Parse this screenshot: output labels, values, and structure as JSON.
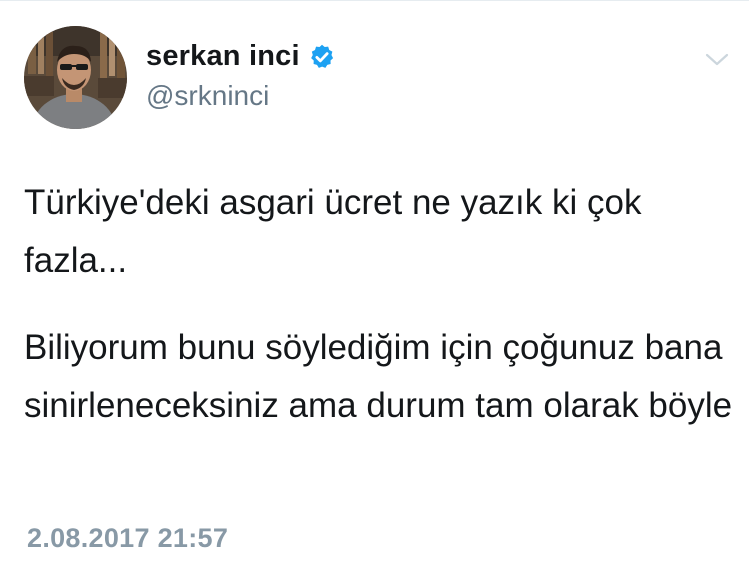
{
  "tweet": {
    "author": {
      "display_name": "serkan inci",
      "handle": "@srkninci",
      "verified_icon": "verified-badge-icon",
      "avatar_icon": "avatar-photo"
    },
    "menu_icon": "chevron-down-icon",
    "paragraphs": [
      "Türkiye'deki asgari ücret ne yazık ki çok fazla...",
      "Biliyorum bunu söylediğim için çoğunuz bana sinirleneceksiniz ama durum tam olarak böyle"
    ],
    "timestamp": "2.08.2017 21:57"
  },
  "colors": {
    "text": "#14171a",
    "handle": "#657786",
    "timestamp": "#8899a6",
    "verified": "#1da1f2",
    "caret": "#ccd6dd"
  }
}
